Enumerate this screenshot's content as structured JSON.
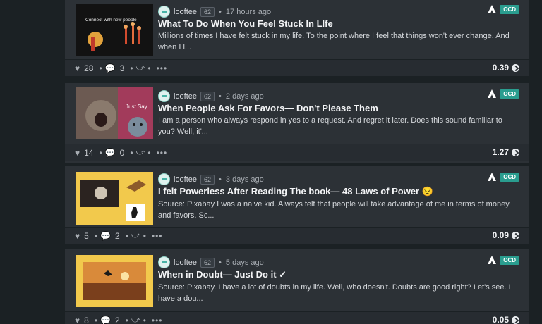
{
  "tribe": {
    "badge": "OCD"
  },
  "posts": [
    {
      "author": "looftee",
      "reputation": "62",
      "time": "17 hours ago",
      "title": "What To Do When You Feel Stuck In LIfe",
      "excerpt": "Millions of times I have felt stuck in my life. To the point where I feel that things won't ever change. And when I l...",
      "likes": "28",
      "comments": "3",
      "payout": "0.39",
      "thumb_text": "Connect with new people"
    },
    {
      "author": "looftee",
      "reputation": "62",
      "time": "2 days ago",
      "title": "When People Ask For Favors— Don't Please Them",
      "excerpt": "I am a person who always respond in yes to a request. And regret it later. Does this sound familiar to you? Well, it'...",
      "likes": "14",
      "comments": "0",
      "payout": "1.27",
      "thumb_text": "Just Say"
    },
    {
      "author": "looftee",
      "reputation": "62",
      "time": "3 days ago",
      "title": "I felt Powerless After Reading The book— 48 Laws of Power 😣",
      "excerpt": "Source: Pixabay I was a naive kid. Always felt that people will take advantage of me in terms of money and favors. Sc...",
      "likes": "5",
      "comments": "2",
      "payout": "0.09"
    },
    {
      "author": "looftee",
      "reputation": "62",
      "time": "5 days ago",
      "title": "When in Doubt— Just Do it ✓",
      "excerpt": "Source: Pixabay. I have a lot of doubts in my life. Well, who doesn't. Doubts are good right? Let's see. I have a dou...",
      "likes": "8",
      "comments": "2",
      "payout": "0.05"
    }
  ]
}
